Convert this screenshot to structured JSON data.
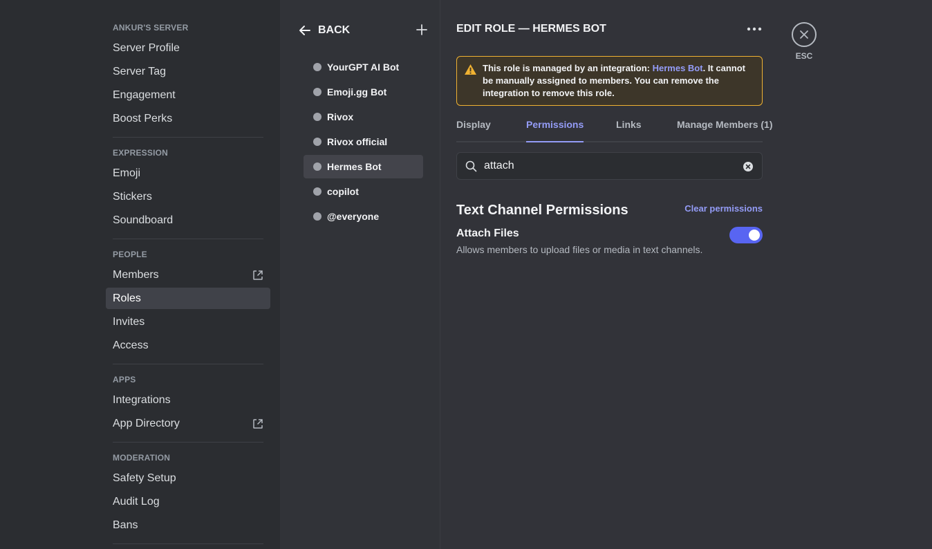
{
  "sidebar": {
    "sections": [
      {
        "header": "ANKUR'S SERVER",
        "items": [
          "Server Profile",
          "Server Tag",
          "Engagement",
          "Boost Perks"
        ]
      },
      {
        "header": "EXPRESSION",
        "items": [
          "Emoji",
          "Stickers",
          "Soundboard"
        ]
      },
      {
        "header": "PEOPLE",
        "items": [
          "Members",
          "Roles",
          "Invites",
          "Access"
        ]
      },
      {
        "header": "APPS",
        "items": [
          "Integrations",
          "App Directory"
        ]
      },
      {
        "header": "MODERATION",
        "items": [
          "Safety Setup",
          "Audit Log",
          "Bans"
        ]
      }
    ],
    "active_item": "Roles"
  },
  "roles_panel": {
    "back_label": "BACK",
    "roles": [
      "YourGPT AI Bot",
      "Emoji.gg Bot",
      "Rivox",
      "Rivox official",
      "Hermes Bot",
      "copilot",
      "@everyone"
    ],
    "active_role": "Hermes Bot"
  },
  "main": {
    "title": "EDIT ROLE — HERMES BOT",
    "warning": {
      "prefix": "This role is managed by an integration: ",
      "link": "Hermes Bot",
      "suffix": ". It cannot be manually assigned to members. You can remove the integration to remove this role."
    },
    "tabs": [
      "Display",
      "Permissions",
      "Links",
      "Manage Members (1)"
    ],
    "active_tab": "Permissions",
    "search_value": "attach",
    "section_title": "Text Channel Permissions",
    "clear_label": "Clear permissions",
    "permission": {
      "name": "Attach Files",
      "description": "Allows members to upload files or media in text channels.",
      "enabled": true
    }
  },
  "esc_label": "ESC",
  "colors": {
    "accent": "#5865f2",
    "link": "#949cf7",
    "warning_border": "#f0b232"
  }
}
